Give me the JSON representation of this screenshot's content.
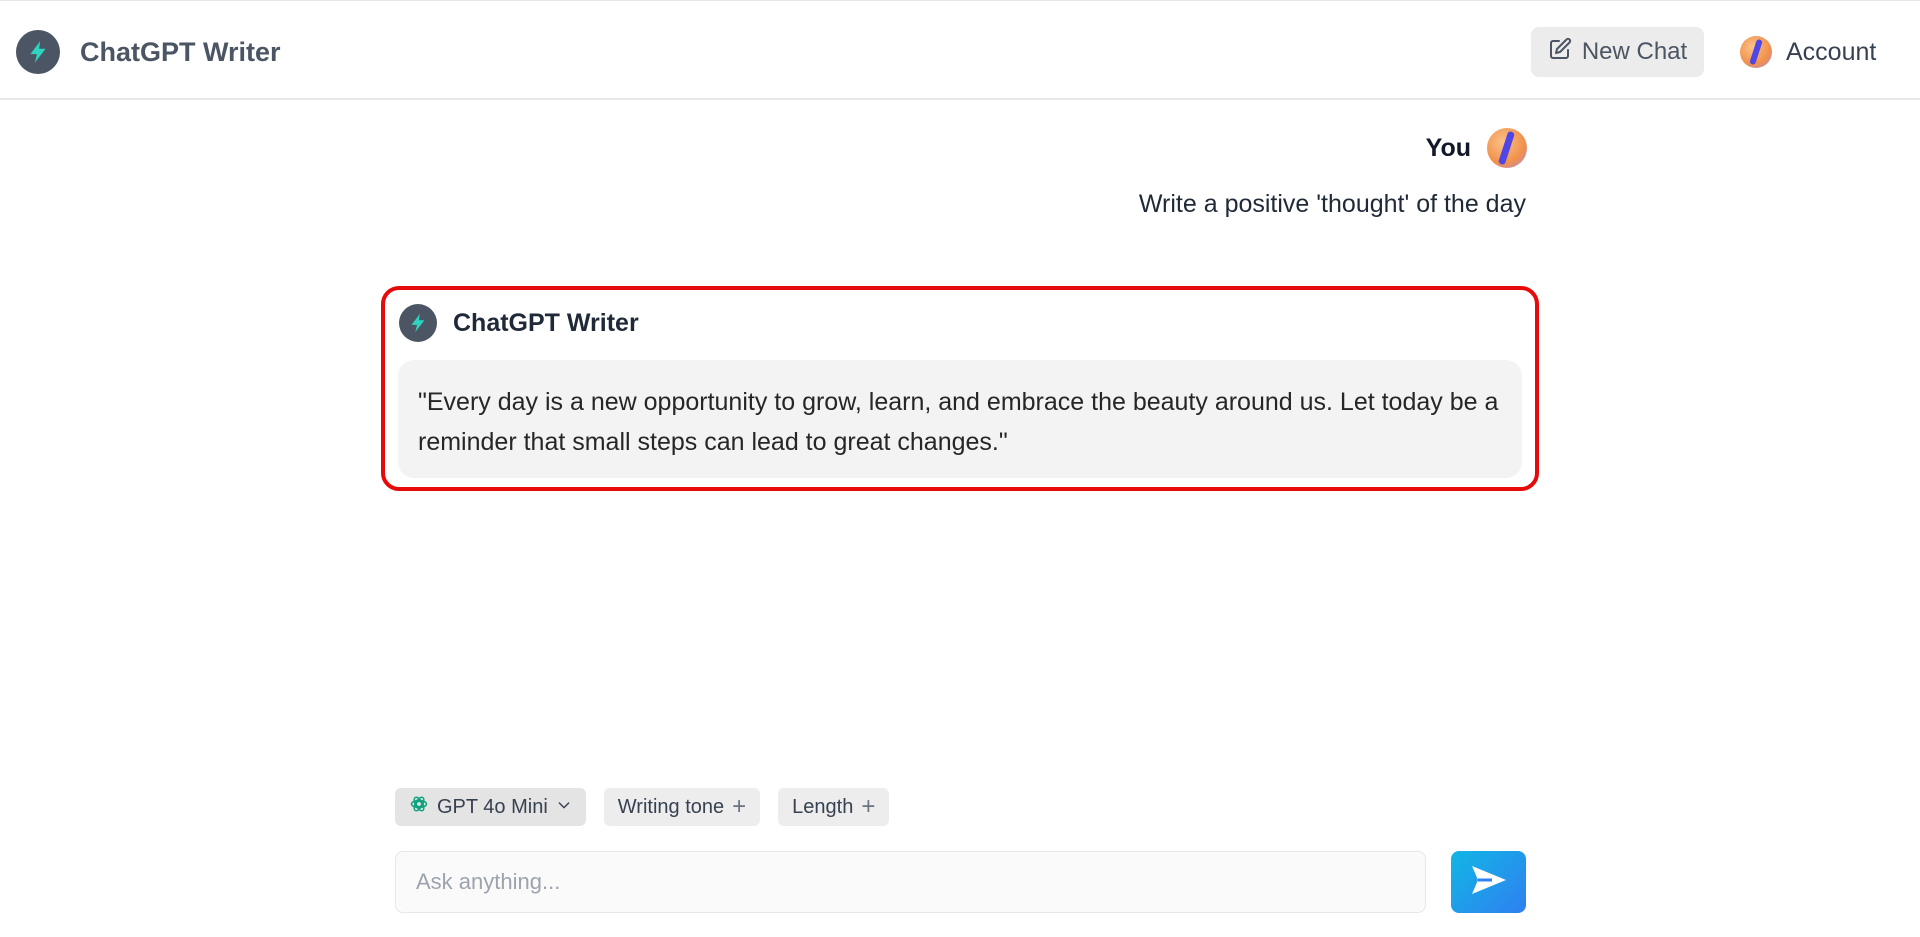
{
  "header": {
    "app_title": "ChatGPT Writer",
    "new_chat_label": "New Chat",
    "account_label": "Account"
  },
  "conversation": {
    "user": {
      "name": "You",
      "message": "Write a positive 'thought' of the day"
    },
    "assistant": {
      "name": "ChatGPT Writer",
      "message": "\"Every day is a new opportunity to grow, learn, and embrace the beauty around us. Let today be a reminder that small steps can lead to great changes.\""
    }
  },
  "composer": {
    "model_label": "GPT 4o Mini",
    "tone_label": "Writing tone",
    "length_label": "Length",
    "placeholder": "Ask anything..."
  },
  "colors": {
    "highlight_border": "#e60a0a",
    "send_button": "#2f80f0",
    "logo_bolt": "#2dd4bf"
  },
  "icons": [
    "bolt-logo-icon",
    "edit-icon",
    "avatar",
    "openai-icon",
    "chevron-down-icon",
    "plus-icon",
    "send-icon"
  ]
}
